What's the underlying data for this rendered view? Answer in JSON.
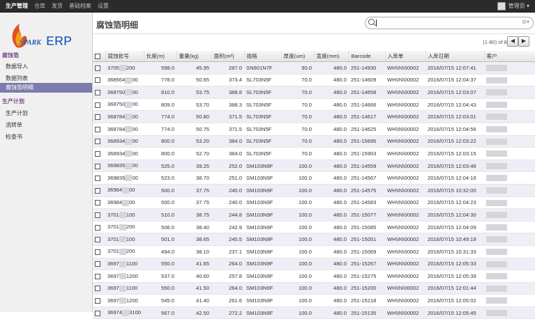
{
  "topnav": {
    "items": [
      "生产管理",
      "仓库",
      "发货",
      "基础档案",
      "设置"
    ],
    "active": 0,
    "user": "管理员"
  },
  "sidebar": {
    "logo_text": "SPARK ERP",
    "sec1": "腐蚀箔",
    "items1": [
      "数据导入",
      "数据列表",
      "腐蚀箔明细"
    ],
    "sec2": "生产计划",
    "items2": [
      "生产计划",
      "流转单",
      "检查书"
    ]
  },
  "page": {
    "title": "腐蚀箔明细"
  },
  "pager": {
    "text": "(1-80) of 86",
    "prev": "◀",
    "next": "▶"
  },
  "search": {
    "options_icon": "⚙▾"
  },
  "table": {
    "columns": [
      "腐蚀批号",
      "长度(m)",
      "重量(kg)",
      "面积(m²)",
      "规格",
      "厚度(um)",
      "宽度(mm)",
      "Barcode",
      "入库单",
      "入库日期",
      "客户"
    ],
    "rows": [
      [
        "3705",
        "200",
        "598.0",
        "45.95",
        "287.0",
        "SN901N7F",
        "90.0",
        "480.0",
        "251-14930",
        "WH\\IN\\00002",
        "2016/07/15 12:07:41"
      ],
      [
        "368564",
        "00",
        "778.0",
        "50.65",
        "373.4",
        "SL703N5F",
        "70.0",
        "480.0",
        "251-14609",
        "WH\\IN\\00002",
        "2016/07/15 12:04:37"
      ],
      [
        "368750",
        "00",
        "810.0",
        "53.75",
        "388.8",
        "SL703N5F",
        "70.0",
        "480.0",
        "251-14658",
        "WH\\IN\\00002",
        "2016/07/15 12:03:07"
      ],
      [
        "368750",
        "00",
        "809.0",
        "53.70",
        "388.3",
        "SL703N5F",
        "70.0",
        "480.0",
        "251-14666",
        "WH\\IN\\00002",
        "2016/07/15 12:04:43"
      ],
      [
        "368784",
        "00",
        "774.0",
        "50.80",
        "371.5",
        "SL703N5F",
        "70.0",
        "480.0",
        "251-14617",
        "WH\\IN\\00002",
        "2016/07/15 12:03:01"
      ],
      [
        "368784",
        "00",
        "774.0",
        "50.75",
        "371.5",
        "SL703N5F",
        "70.0",
        "480.0",
        "251-14625",
        "WH\\IN\\00002",
        "2016/07/15 12:04:56"
      ],
      [
        "368934",
        "00",
        "800.0",
        "53.20",
        "384.0",
        "SL703N5F",
        "70.0",
        "480.0",
        "251-15895",
        "WH\\IN\\00002",
        "2016/07/15 12:03:22"
      ],
      [
        "368934",
        "00",
        "800.0",
        "52.70",
        "384.0",
        "SL703N5F",
        "70.0",
        "480.0",
        "251-15903",
        "WH\\IN\\00002",
        "2016/07/15 12:03:15"
      ],
      [
        "369835",
        "00",
        "525.0",
        "39.25",
        "252.0",
        "SM103N9F",
        "100.0",
        "480.0",
        "251-14559",
        "WH\\IN\\00002",
        "2016/07/15 12:03:46"
      ],
      [
        "369835",
        "00",
        "523.0",
        "38.70",
        "251.0",
        "SM103N9F",
        "100.0",
        "480.0",
        "251-14567",
        "WH\\IN\\00002",
        "2016/07/15 12:04:16"
      ],
      [
        "36984",
        "00",
        "500.0",
        "37.75",
        "240.0",
        "SM103N9F",
        "100.0",
        "480.0",
        "251-14575",
        "WH\\IN\\00002",
        "2016/07/15 10:32:00"
      ],
      [
        "36984",
        "00",
        "500.0",
        "37.75",
        "240.0",
        "SM103N9F",
        "100.0",
        "480.0",
        "251-14583",
        "WH\\IN\\00002",
        "2016/07/15 12:04:23"
      ],
      [
        "3701",
        "100",
        "510.0",
        "38.75",
        "244.8",
        "SM103N9F",
        "100.0",
        "480.0",
        "251-15077",
        "WH\\IN\\00002",
        "2016/07/15 12:04:30"
      ],
      [
        "3701",
        "200",
        "506.0",
        "38.40",
        "242.9",
        "SM103N9F",
        "100.0",
        "480.0",
        "251-15085",
        "WH\\IN\\00002",
        "2016/07/15 12:04:09"
      ],
      [
        "3701",
        "100",
        "501.0",
        "38.65",
        "240.5",
        "SM103N9F",
        "100.0",
        "480.0",
        "251-15051",
        "WH\\IN\\00002",
        "2016/07/15 10:49:19"
      ],
      [
        "3701",
        "200",
        "494.0",
        "38.10",
        "237.1",
        "SM103N9F",
        "100.0",
        "480.0",
        "251-15069",
        "WH\\IN\\00002",
        "2016/07/15 10:31:33"
      ],
      [
        "3697",
        "1100",
        "550.0",
        "41.65",
        "264.0",
        "SM103N9F",
        "100.0",
        "480.0",
        "251-15267",
        "WH\\IN\\00002",
        "2016/07/15 12:05:33"
      ],
      [
        "3697",
        "1200",
        "537.0",
        "40.60",
        "257.8",
        "SM103N9F",
        "100.0",
        "480.0",
        "251-15275",
        "WH\\IN\\00002",
        "2016/07/15 12:05:39"
      ],
      [
        "3697",
        "1100",
        "550.0",
        "41.50",
        "264.0",
        "SM103N9F",
        "100.0",
        "480.0",
        "251-15200",
        "WH\\IN\\00002",
        "2016/07/15 12:01:44"
      ],
      [
        "3697",
        "1200",
        "545.0",
        "41.40",
        "261.6",
        "SM103N9F",
        "100.0",
        "480.0",
        "251-15218",
        "WH\\IN\\00002",
        "2016/07/15 12:05:02"
      ],
      [
        "36974",
        "3100",
        "567.0",
        "42.50",
        "272.2",
        "SM103N9F",
        "100.0",
        "480.0",
        "251-15135",
        "WH\\IN\\00002",
        "2016/07/15 12:05:45"
      ]
    ]
  }
}
